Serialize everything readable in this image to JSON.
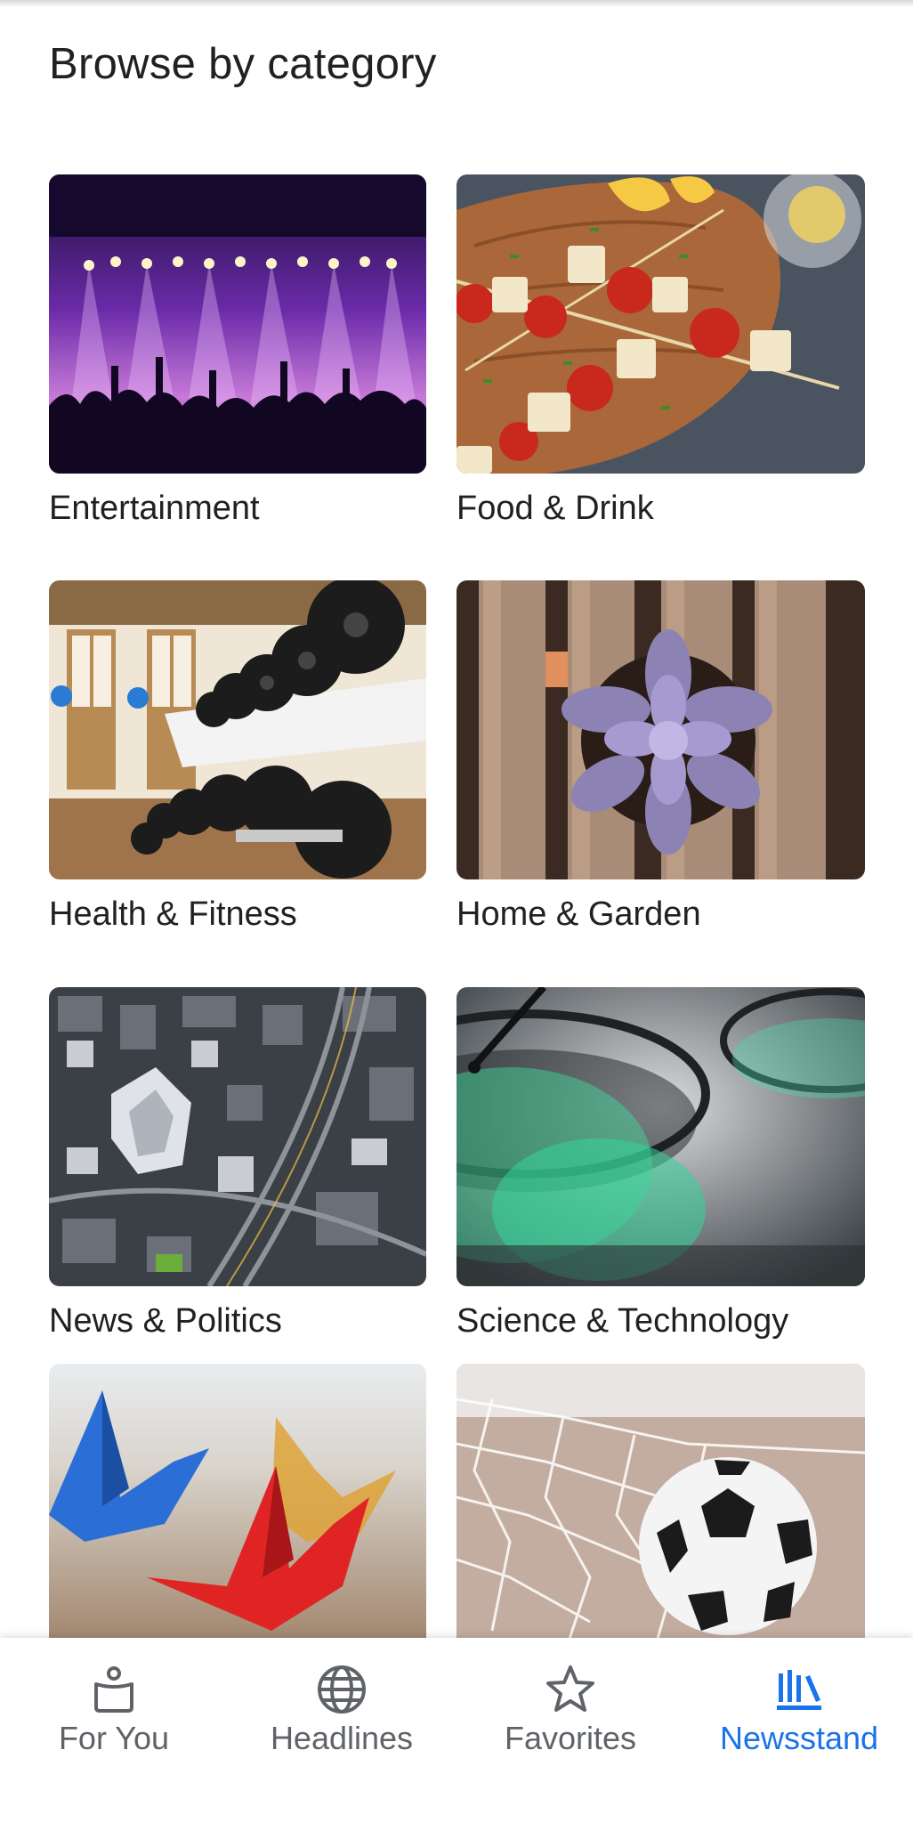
{
  "page": {
    "title": "Browse by category"
  },
  "categories": [
    {
      "label": "Entertainment"
    },
    {
      "label": "Food & Drink"
    },
    {
      "label": "Health & Fitness"
    },
    {
      "label": "Home & Garden"
    },
    {
      "label": "News & Politics"
    },
    {
      "label": "Science & Technology"
    },
    {
      "label": ""
    },
    {
      "label": ""
    }
  ],
  "bottom_nav": {
    "items": [
      {
        "label": "For You",
        "icon": "for-you-icon",
        "active": false
      },
      {
        "label": "Headlines",
        "icon": "globe-icon",
        "active": false
      },
      {
        "label": "Favorites",
        "icon": "star-icon",
        "active": false
      },
      {
        "label": "Newsstand",
        "icon": "newsstand-icon",
        "active": true
      }
    ]
  },
  "colors": {
    "accent": "#1a73e8",
    "inactive": "#5f6368",
    "text": "#202124"
  }
}
